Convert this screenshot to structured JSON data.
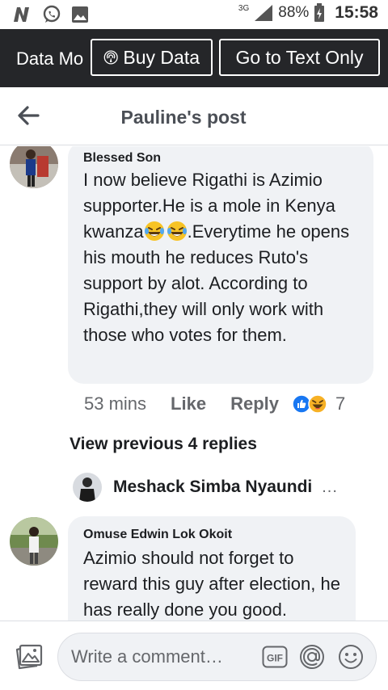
{
  "status_bar": {
    "network_label": "3G",
    "battery_percent": "88%",
    "time": "15:58",
    "icons": [
      "n-app-icon",
      "whatsapp-icon",
      "gallery-icon",
      "signal-icon",
      "battery-icon"
    ]
  },
  "data_bar": {
    "mode_label": "Data Mo",
    "buy_label": "Buy Data",
    "text_only_label": "Go to Text Only"
  },
  "header": {
    "title": "Pauline's post"
  },
  "comments": [
    {
      "author": "Blessed Son",
      "text_parts": [
        "I now believe Rigathi is Azimio supporter.He is a mole in Kenya kwanza",
        ".Everytime he opens his mouth he reduces Ruto's support by alot. According to Rigathi,they will only work with those who votes for them."
      ],
      "emojis": [
        "laughing-tears-emoji",
        "laughing-tears-emoji"
      ],
      "time": "53 mins",
      "like_label": "Like",
      "reply_label": "Reply",
      "reactions": [
        "like-reaction",
        "haha-reaction"
      ],
      "reaction_count": "7"
    },
    {
      "author": "Omuse Edwin Lok Okoit",
      "text": "Azimio should not forget to reward this guy after election, he has really done you good."
    }
  ],
  "replies": {
    "view_previous_label": "View previous 4 replies",
    "last_reply_author": "Meshack Simba Nyaundi",
    "more_label": "..."
  },
  "composer": {
    "placeholder": "Write a comment…",
    "gif_label": "GIF"
  },
  "colors": {
    "data_bar_bg": "#252629",
    "bubble_bg": "#f0f2f5",
    "like_blue": "#1877f2",
    "haha_yellow": "#f7b125"
  }
}
